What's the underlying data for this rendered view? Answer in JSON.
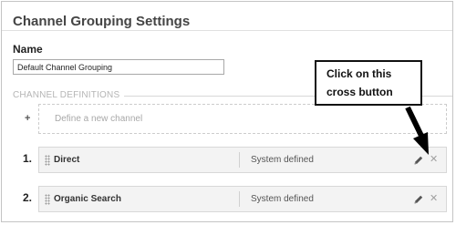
{
  "page": {
    "title": "Channel Grouping Settings",
    "name_label": "Name",
    "name_value": "Default Channel Grouping",
    "section_label": "CHANNEL DEFINITIONS"
  },
  "define": {
    "plus": "+",
    "text": "Define a new channel"
  },
  "channels": [
    {
      "number": "1.",
      "name": "Direct",
      "type": "System defined",
      "edit_icon": "pencil-icon",
      "remove_icon": "close-icon"
    },
    {
      "number": "2.",
      "name": "Organic Search",
      "type": "System defined",
      "edit_icon": "pencil-icon",
      "remove_icon": "close-icon"
    }
  ],
  "callout": {
    "line1": "Click on this",
    "line2": "cross button"
  },
  "close_glyph": "✕"
}
